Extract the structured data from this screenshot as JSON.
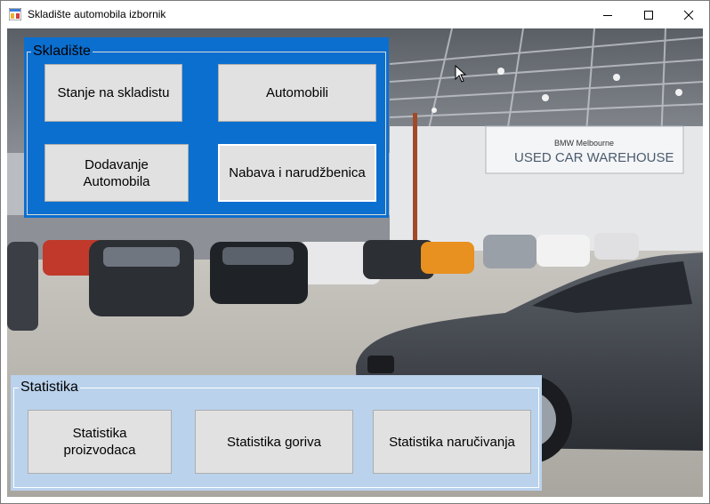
{
  "window": {
    "title": "Skladište automobila izbornik",
    "controls": {
      "minimize": "—",
      "maximize": "☐",
      "close": "✕"
    }
  },
  "warehouse_group": {
    "label": "Skladište",
    "buttons": {
      "stock": "Stanje na skladistu",
      "cars": "Automobili",
      "add_car": "Dodavanje Automobila",
      "procurement": "Nabava i narudžbenica"
    }
  },
  "stats_group": {
    "label": "Statistika",
    "buttons": {
      "manufacturers": "Statistika proizvodaca",
      "fuel": "Statistika goriva",
      "orders": "Statistika naručivanja"
    }
  },
  "background_sign": {
    "brand": "BMW Melbourne",
    "title": "USED CAR WAREHOUSE"
  },
  "colors": {
    "warehouse_panel": "#0b6fd0",
    "stats_panel": "#bad2ec",
    "button_face": "#e1e1e1"
  }
}
